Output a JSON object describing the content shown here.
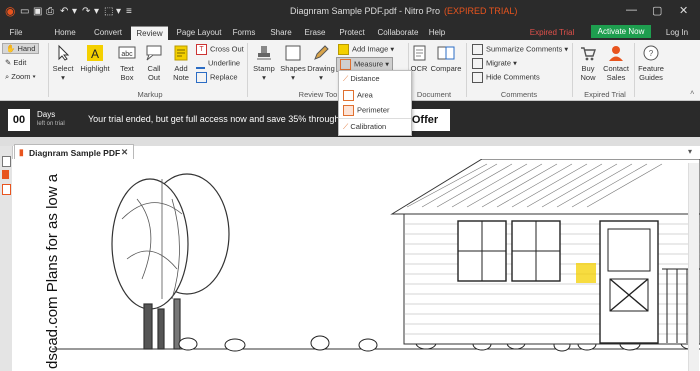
{
  "window": {
    "title": "Diagnram Sample PDF.pdf - Nitro Pro",
    "title_suffix": "(EXPIRED TRIAL)",
    "expired_label": "Expired Trial",
    "activate_label": "Activate Now",
    "login_label": "Log In",
    "colors": {
      "accent_red": "#e8541e",
      "activate_green": "#1e9e4f",
      "expired_red": "#e0504a"
    }
  },
  "tabs": [
    "File",
    "Home",
    "Convert",
    "Review",
    "Page Layout",
    "Forms",
    "Share",
    "Erase",
    "Protect",
    "Collaborate",
    "Help"
  ],
  "active_tab": "Review",
  "ribbon": {
    "hand": "Hand",
    "edit": "Edit",
    "zoom": "Zoom",
    "select": "Select",
    "highlight": "Highlight",
    "text_box": "Text Box",
    "call_out": "Call Out",
    "add_note": "Add Note",
    "cross_out": "Cross Out",
    "underline": "Underline",
    "replace": "Replace",
    "markup_group": "Markup",
    "stamp": "Stamp",
    "shapes": "Shapes",
    "drawing": "Drawing",
    "add_image": "Add Image",
    "measure": "Measure",
    "review_tools_group": "Review Too",
    "ocr": "OCR",
    "compare": "Compare",
    "document_group": "Document",
    "summarize_comments": "Summarize Comments",
    "migrate": "Migrate",
    "hide_comments": "Hide Comments",
    "comments_group": "Comments",
    "buy_now": "Buy Now",
    "contact_sales": "Contact Sales",
    "expired_trial_group": "Expired Trial",
    "feature_guides": "Feature Guides"
  },
  "measure_menu": [
    "Distance",
    "Area",
    "Perimeter",
    "Calibration"
  ],
  "banner": {
    "days_count": "00",
    "days_label": "Days",
    "days_sub": "left on trial",
    "message": "Your trial ended, but get full access now and save 35% through M",
    "offer_label": "Offer"
  },
  "document": {
    "tab_label": "Diagnram Sample PDF",
    "side_text": "dscad.com Plans for as low a"
  }
}
